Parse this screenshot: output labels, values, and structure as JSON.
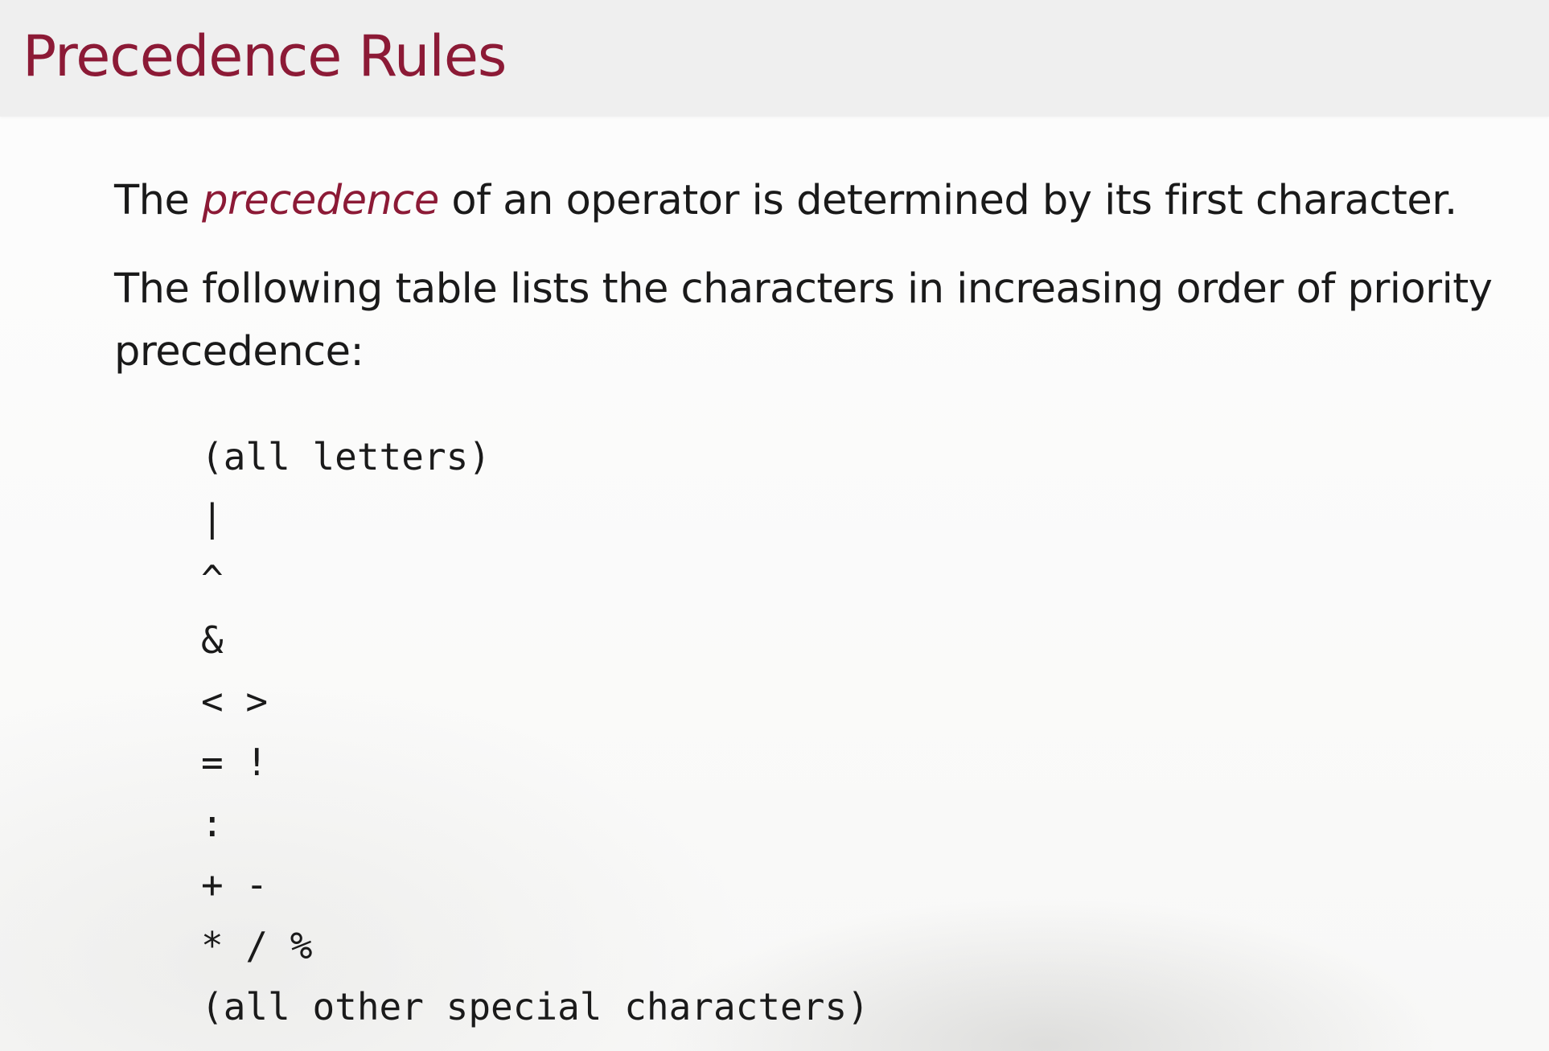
{
  "slide": {
    "title": "Precedence Rules",
    "paragraph1": {
      "before": "The ",
      "emphasis": "precedence",
      "after": " of an operator is determined by its first character."
    },
    "paragraph2_line1": "The following table lists the characters in increasing order of priority",
    "paragraph2_line2": "precedence:",
    "table_rows": [
      "(all letters)",
      "|",
      "^",
      "&",
      "< >",
      "= !",
      ":",
      "+ -",
      "* / %",
      "(all other special characters)"
    ],
    "colors": {
      "accent": "#8c1a36",
      "title_bar": "#efefef",
      "text": "#1a1a1a"
    }
  }
}
